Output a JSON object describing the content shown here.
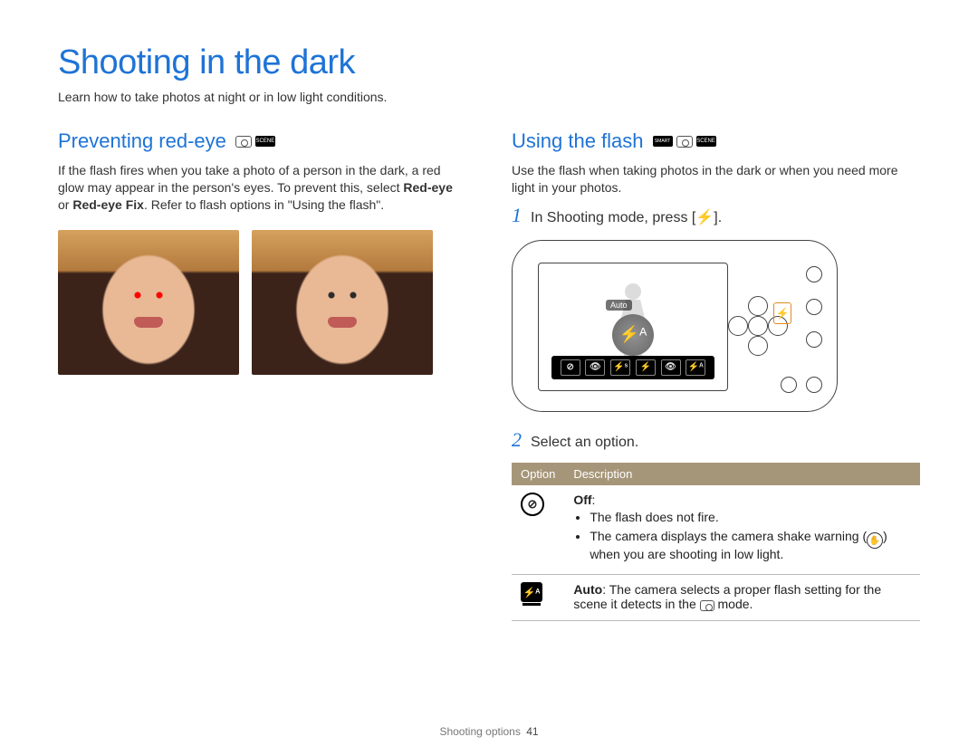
{
  "page": {
    "title": "Shooting in the dark",
    "intro": "Learn how to take photos at night or in low light conditions."
  },
  "left": {
    "heading": "Preventing red-eye",
    "body_before_bold1": "If the flash fires when you take a photo of a person in the dark, a red glow may appear in the person's eyes. To prevent this, select ",
    "bold1": "Red-eye",
    "between_bold": " or ",
    "bold2": "Red-eye Fix",
    "body_after_bold2": ". Refer to flash options in \"Using the flash\"."
  },
  "right": {
    "heading": "Using the flash",
    "body": "Use the flash when taking photos in the dark or when you need more light in your photos.",
    "step1_num": "1",
    "step1_text_a": "In Shooting mode, press [",
    "step1_flash_glyph": "⚡",
    "step1_text_b": "].",
    "camera_auto_label": "Auto",
    "flash_badge_glyph": "⚡ᴬ",
    "highlight_glyph": "⚡",
    "flash_bar": [
      "⊘",
      "👁",
      "⚡ˢ",
      "⚡",
      "👁",
      "⚡ᴬ"
    ],
    "step2_num": "2",
    "step2_text": "Select an option.",
    "table": {
      "head_option": "Option",
      "head_description": "Description",
      "rows": [
        {
          "icon_glyph": "⊘",
          "icon_kind": "off",
          "title": "Off",
          "bullets": [
            "The flash does not fire.",
            "The camera displays the camera shake warning (    ) when you are shooting in low light."
          ],
          "shake_glyph": "✋"
        },
        {
          "icon_glyph": "⚡ᴬ",
          "icon_kind": "smart",
          "title": "Auto",
          "desc_a": ": The camera selects a proper flash setting for the scene it detects in the ",
          "desc_b": " mode."
        }
      ]
    }
  },
  "footer": {
    "section": "Shooting options",
    "page": "41"
  }
}
